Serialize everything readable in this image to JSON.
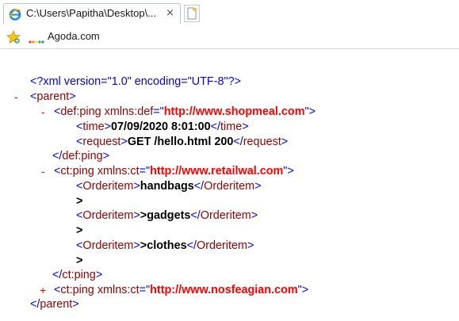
{
  "tab": {
    "title": "C:\\Users\\Papitha\\Desktop\\...",
    "close_glyph": "×",
    "icon": "internet-explorer-icon"
  },
  "new_tab_icon": "new-tab-icon",
  "favorites": {
    "star_icon": "add-favorites-star-icon",
    "items": [
      {
        "label": "Agoda.com",
        "icon": "agoda-logo-icon"
      }
    ]
  },
  "xml": {
    "declaration": "<?xml version=\"1.0\" encoding=\"UTF-8\"?>",
    "collapse_glyph": "-",
    "expand_glyph": "+",
    "parent_open": "parent",
    "parent_close": "parent",
    "def_ping": {
      "tag": "def:ping",
      "attr_name": "xmlns:def",
      "attr_value": "http://www.shopmeal.com",
      "children": [
        {
          "tag": "time",
          "text": "07/09/2020 8:01:00"
        },
        {
          "tag": "request",
          "text": "GET /hello.html 200"
        }
      ]
    },
    "ct_ping": {
      "tag": "ct:ping",
      "attr_name": "xmlns:ct",
      "attr_value": "http://www.retailwal.com",
      "children": [
        {
          "tag": "Orderitem",
          "text": "handbags",
          "after": ">"
        },
        {
          "tag": "Orderitem",
          "text": ">gadgets",
          "after": ">"
        },
        {
          "tag": "Orderitem",
          "text": ">clothes",
          "after": ">"
        }
      ]
    },
    "ct_ping_collapsed": {
      "tag": "ct:ping",
      "attr_name": "xmlns:ct",
      "attr_value": "http://www.nosfeagian.com"
    }
  }
}
